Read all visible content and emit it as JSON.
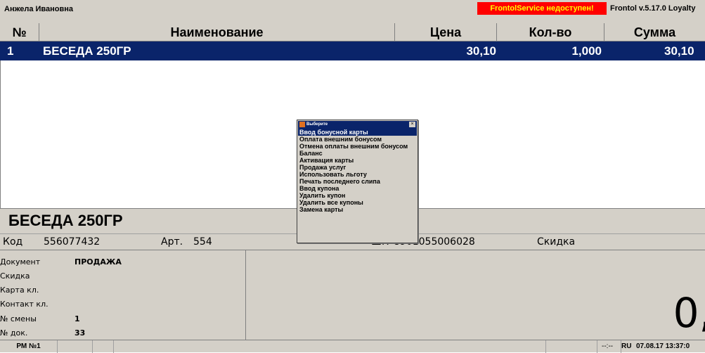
{
  "topbar": {
    "user": "Анжела Ивановна",
    "alert": "FrontolService недоступен!",
    "version": "Frontol v.5.17.0 Loyalty"
  },
  "table": {
    "headers": {
      "num": "№",
      "name": "Наименование",
      "price": "Цена",
      "qty": "Кол-во",
      "sum": "Сумма"
    },
    "rows": [
      {
        "num": "1",
        "name": "БЕСЕДА 250ГР",
        "price": "30,10",
        "qty": "1,000",
        "sum": "30,10"
      }
    ]
  },
  "product": {
    "name": "БЕСЕДА 250ГР",
    "code_label": "Код",
    "code": "556077432",
    "art_label": "Арт.",
    "art": "554",
    "barcode_label": "ШК",
    "barcode": "8901055006028",
    "discount_label": "Скидка"
  },
  "document": {
    "doc_label": "Документ",
    "doc_value": "ПРОДАЖА",
    "discount_label": "Скидка",
    "card_label": "Карта кл.",
    "contact_label": "Контакт кл.",
    "shift_label": "№ смены",
    "shift_value": "1",
    "docnum_label": "№ док.",
    "docnum_value": "33"
  },
  "total": {
    "value": "0,"
  },
  "popup": {
    "title": "Выберите",
    "items": [
      "Ввод бонусной карты",
      "Оплата внешним бонусом",
      "Отмена оплаты внешним бонусом",
      "Баланс",
      "Активация карты",
      "Продажа услуг",
      "Использовать льготу",
      "Печать последнего слипа",
      "Ввод купона",
      "Удалить купон",
      "Удалить все купоны",
      "Замена карты"
    ],
    "selected_index": 0
  },
  "statusbar": {
    "workstation": "РМ №1",
    "time_placeholder": "--:--",
    "lang": "RU",
    "datetime": "07.08.17 13:37:0"
  },
  "colors": {
    "selection": "#0a246a",
    "alert_bg": "#ff0000",
    "alert_text": "#ffff00",
    "panel": "#d4d0c8"
  }
}
